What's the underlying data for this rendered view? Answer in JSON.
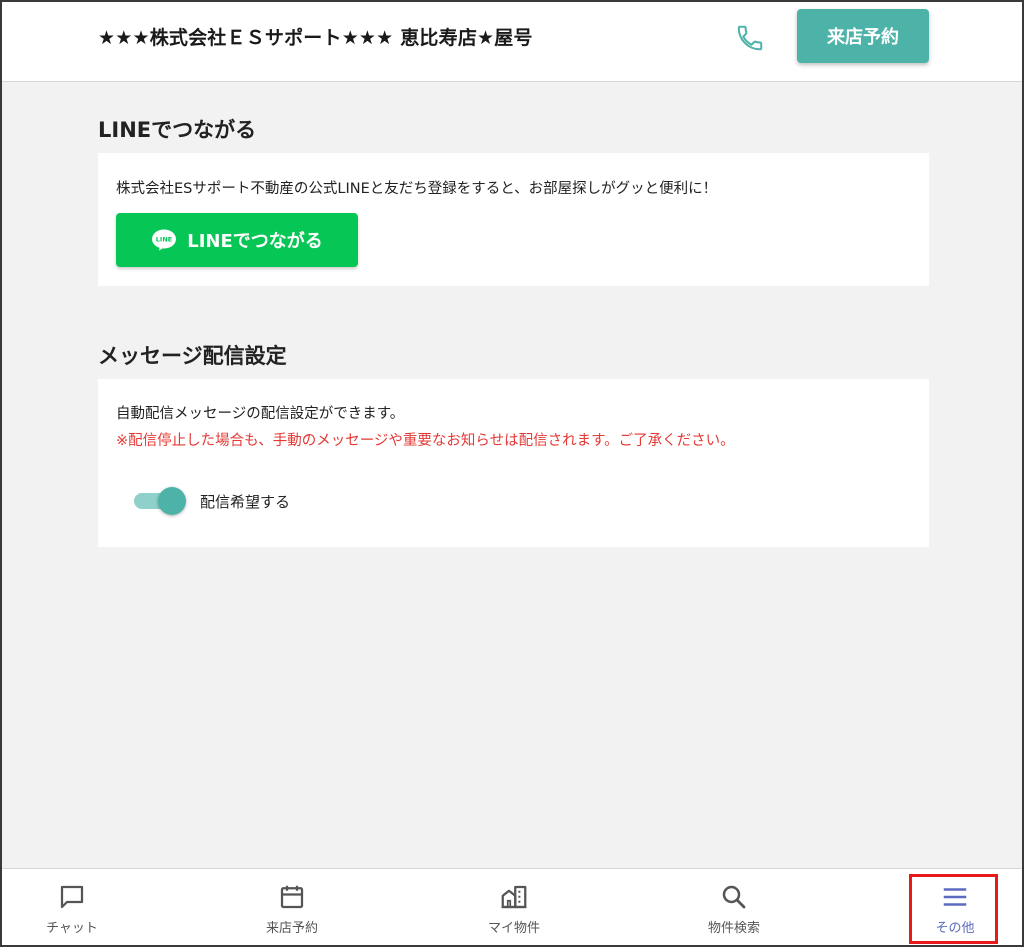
{
  "header": {
    "title": "★★★株式会社ＥＳサポート★★★ 恵比寿店★屋号",
    "phone_icon": "phone-icon",
    "reserve_label": "来店予約"
  },
  "line_section": {
    "title": "LINEでつながる",
    "description": "株式会社ESサポート不動産の公式LINEと友だち登録をすると、お部屋探しがグッと便利に！",
    "button_label": "LINEでつながる",
    "logo_text": "LINE",
    "button_color": "#06c755"
  },
  "message_section": {
    "title": "メッセージ配信設定",
    "description": "自動配信メッセージの配信設定ができます。",
    "warning": "※配信停止した場合も、手動のメッセージや重要なお知らせは配信されます。ご了承ください。",
    "toggle_label": "配信希望する",
    "toggle_on": true,
    "accent_color": "#4db3a9",
    "warning_color": "#e53935"
  },
  "bottom_nav": {
    "items": [
      {
        "label": "チャット",
        "icon": "chat-icon"
      },
      {
        "label": "来店予約",
        "icon": "calendar-icon"
      },
      {
        "label": "マイ物件",
        "icon": "building-icon"
      },
      {
        "label": "物件検索",
        "icon": "search-icon"
      },
      {
        "label": "その他",
        "icon": "menu-icon",
        "active": true
      }
    ],
    "active_color": "#5c6bc0",
    "highlight_color": "#e8191b"
  }
}
